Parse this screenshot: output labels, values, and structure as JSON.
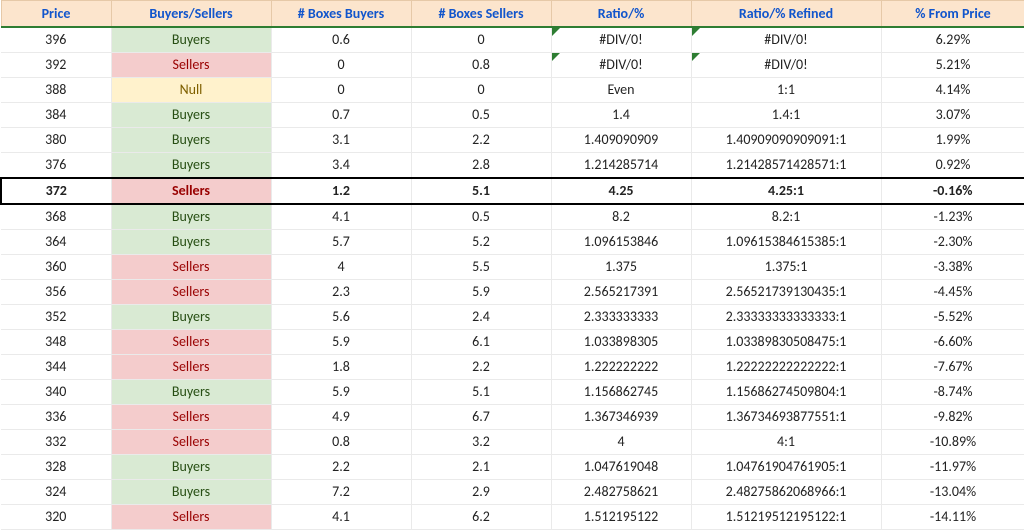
{
  "columns": {
    "price": "Price",
    "bs": "Buyers/Sellers",
    "boxes_buyers": "# Boxes Buyers",
    "boxes_sellers": "# Boxes Sellers",
    "ratio": "Ratio/%",
    "ratio_refined": "Ratio/% Refined",
    "pct_from_price": "% From Price"
  },
  "highlight_price": 372,
  "rows": [
    {
      "price": 396,
      "bs": "Buyers",
      "boxes_buyers": "0.6",
      "boxes_sellers": "0",
      "ratio": "#DIV/0!",
      "ratio_err": true,
      "ratio_refined": "#DIV/0!",
      "refined_err": true,
      "pct_from_price": "6.29%"
    },
    {
      "price": 392,
      "bs": "Sellers",
      "boxes_buyers": "0",
      "boxes_sellers": "0.8",
      "ratio": "#DIV/0!",
      "ratio_err": true,
      "ratio_refined": "#DIV/0!",
      "refined_err": true,
      "pct_from_price": "5.21%"
    },
    {
      "price": 388,
      "bs": "Null",
      "boxes_buyers": "0",
      "boxes_sellers": "0",
      "ratio": "Even",
      "ratio_refined": "1:1",
      "pct_from_price": "4.14%"
    },
    {
      "price": 384,
      "bs": "Buyers",
      "boxes_buyers": "0.7",
      "boxes_sellers": "0.5",
      "ratio": "1.4",
      "ratio_refined": "1.4:1",
      "pct_from_price": "3.07%"
    },
    {
      "price": 380,
      "bs": "Buyers",
      "boxes_buyers": "3.1",
      "boxes_sellers": "2.2",
      "ratio": "1.409090909",
      "ratio_refined": "1.40909090909091:1",
      "pct_from_price": "1.99%"
    },
    {
      "price": 376,
      "bs": "Buyers",
      "boxes_buyers": "3.4",
      "boxes_sellers": "2.8",
      "ratio": "1.214285714",
      "ratio_refined": "1.21428571428571:1",
      "pct_from_price": "0.92%"
    },
    {
      "price": 372,
      "bs": "Sellers",
      "boxes_buyers": "1.2",
      "boxes_sellers": "5.1",
      "ratio": "4.25",
      "ratio_refined": "4.25:1",
      "pct_from_price": "-0.16%"
    },
    {
      "price": 368,
      "bs": "Buyers",
      "boxes_buyers": "4.1",
      "boxes_sellers": "0.5",
      "ratio": "8.2",
      "ratio_refined": "8.2:1",
      "pct_from_price": "-1.23%"
    },
    {
      "price": 364,
      "bs": "Buyers",
      "boxes_buyers": "5.7",
      "boxes_sellers": "5.2",
      "ratio": "1.096153846",
      "ratio_refined": "1.09615384615385:1",
      "pct_from_price": "-2.30%"
    },
    {
      "price": 360,
      "bs": "Sellers",
      "boxes_buyers": "4",
      "boxes_sellers": "5.5",
      "ratio": "1.375",
      "ratio_refined": "1.375:1",
      "pct_from_price": "-3.38%"
    },
    {
      "price": 356,
      "bs": "Sellers",
      "boxes_buyers": "2.3",
      "boxes_sellers": "5.9",
      "ratio": "2.565217391",
      "ratio_refined": "2.56521739130435:1",
      "pct_from_price": "-4.45%"
    },
    {
      "price": 352,
      "bs": "Buyers",
      "boxes_buyers": "5.6",
      "boxes_sellers": "2.4",
      "ratio": "2.333333333",
      "ratio_refined": "2.33333333333333:1",
      "pct_from_price": "-5.52%"
    },
    {
      "price": 348,
      "bs": "Sellers",
      "boxes_buyers": "5.9",
      "boxes_sellers": "6.1",
      "ratio": "1.033898305",
      "ratio_refined": "1.03389830508475:1",
      "pct_from_price": "-6.60%"
    },
    {
      "price": 344,
      "bs": "Sellers",
      "boxes_buyers": "1.8",
      "boxes_sellers": "2.2",
      "ratio": "1.222222222",
      "ratio_refined": "1.22222222222222:1",
      "pct_from_price": "-7.67%"
    },
    {
      "price": 340,
      "bs": "Buyers",
      "boxes_buyers": "5.9",
      "boxes_sellers": "5.1",
      "ratio": "1.156862745",
      "ratio_refined": "1.15686274509804:1",
      "pct_from_price": "-8.74%"
    },
    {
      "price": 336,
      "bs": "Sellers",
      "boxes_buyers": "4.9",
      "boxes_sellers": "6.7",
      "ratio": "1.367346939",
      "ratio_refined": "1.36734693877551:1",
      "pct_from_price": "-9.82%"
    },
    {
      "price": 332,
      "bs": "Sellers",
      "boxes_buyers": "0.8",
      "boxes_sellers": "3.2",
      "ratio": "4",
      "ratio_refined": "4:1",
      "pct_from_price": "-10.89%"
    },
    {
      "price": 328,
      "bs": "Buyers",
      "boxes_buyers": "2.2",
      "boxes_sellers": "2.1",
      "ratio": "1.047619048",
      "ratio_refined": "1.04761904761905:1",
      "pct_from_price": "-11.97%"
    },
    {
      "price": 324,
      "bs": "Buyers",
      "boxes_buyers": "7.2",
      "boxes_sellers": "2.9",
      "ratio": "2.482758621",
      "ratio_refined": "2.48275862068966:1",
      "pct_from_price": "-13.04%"
    },
    {
      "price": 320,
      "bs": "Sellers",
      "boxes_buyers": "4.1",
      "boxes_sellers": "6.2",
      "ratio": "1.512195122",
      "ratio_refined": "1.51219512195122:1",
      "pct_from_price": "-14.11%"
    }
  ]
}
